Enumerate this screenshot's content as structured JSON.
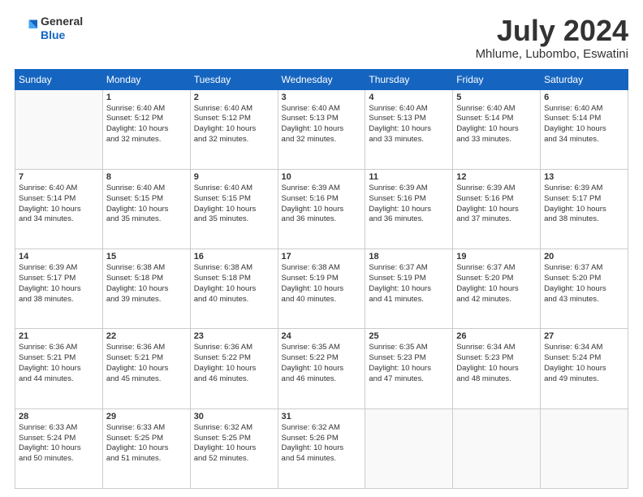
{
  "logo": {
    "general": "General",
    "blue": "Blue"
  },
  "header": {
    "month": "July 2024",
    "location": "Mhlume, Lubombo, Eswatini"
  },
  "weekdays": [
    "Sunday",
    "Monday",
    "Tuesday",
    "Wednesday",
    "Thursday",
    "Friday",
    "Saturday"
  ],
  "weeks": [
    [
      {
        "day": "",
        "info": ""
      },
      {
        "day": "1",
        "info": "Sunrise: 6:40 AM\nSunset: 5:12 PM\nDaylight: 10 hours\nand 32 minutes."
      },
      {
        "day": "2",
        "info": "Sunrise: 6:40 AM\nSunset: 5:12 PM\nDaylight: 10 hours\nand 32 minutes."
      },
      {
        "day": "3",
        "info": "Sunrise: 6:40 AM\nSunset: 5:13 PM\nDaylight: 10 hours\nand 32 minutes."
      },
      {
        "day": "4",
        "info": "Sunrise: 6:40 AM\nSunset: 5:13 PM\nDaylight: 10 hours\nand 33 minutes."
      },
      {
        "day": "5",
        "info": "Sunrise: 6:40 AM\nSunset: 5:14 PM\nDaylight: 10 hours\nand 33 minutes."
      },
      {
        "day": "6",
        "info": "Sunrise: 6:40 AM\nSunset: 5:14 PM\nDaylight: 10 hours\nand 34 minutes."
      }
    ],
    [
      {
        "day": "7",
        "info": "Sunrise: 6:40 AM\nSunset: 5:14 PM\nDaylight: 10 hours\nand 34 minutes."
      },
      {
        "day": "8",
        "info": "Sunrise: 6:40 AM\nSunset: 5:15 PM\nDaylight: 10 hours\nand 35 minutes."
      },
      {
        "day": "9",
        "info": "Sunrise: 6:40 AM\nSunset: 5:15 PM\nDaylight: 10 hours\nand 35 minutes."
      },
      {
        "day": "10",
        "info": "Sunrise: 6:39 AM\nSunset: 5:16 PM\nDaylight: 10 hours\nand 36 minutes."
      },
      {
        "day": "11",
        "info": "Sunrise: 6:39 AM\nSunset: 5:16 PM\nDaylight: 10 hours\nand 36 minutes."
      },
      {
        "day": "12",
        "info": "Sunrise: 6:39 AM\nSunset: 5:16 PM\nDaylight: 10 hours\nand 37 minutes."
      },
      {
        "day": "13",
        "info": "Sunrise: 6:39 AM\nSunset: 5:17 PM\nDaylight: 10 hours\nand 38 minutes."
      }
    ],
    [
      {
        "day": "14",
        "info": "Sunrise: 6:39 AM\nSunset: 5:17 PM\nDaylight: 10 hours\nand 38 minutes."
      },
      {
        "day": "15",
        "info": "Sunrise: 6:38 AM\nSunset: 5:18 PM\nDaylight: 10 hours\nand 39 minutes."
      },
      {
        "day": "16",
        "info": "Sunrise: 6:38 AM\nSunset: 5:18 PM\nDaylight: 10 hours\nand 40 minutes."
      },
      {
        "day": "17",
        "info": "Sunrise: 6:38 AM\nSunset: 5:19 PM\nDaylight: 10 hours\nand 40 minutes."
      },
      {
        "day": "18",
        "info": "Sunrise: 6:37 AM\nSunset: 5:19 PM\nDaylight: 10 hours\nand 41 minutes."
      },
      {
        "day": "19",
        "info": "Sunrise: 6:37 AM\nSunset: 5:20 PM\nDaylight: 10 hours\nand 42 minutes."
      },
      {
        "day": "20",
        "info": "Sunrise: 6:37 AM\nSunset: 5:20 PM\nDaylight: 10 hours\nand 43 minutes."
      }
    ],
    [
      {
        "day": "21",
        "info": "Sunrise: 6:36 AM\nSunset: 5:21 PM\nDaylight: 10 hours\nand 44 minutes."
      },
      {
        "day": "22",
        "info": "Sunrise: 6:36 AM\nSunset: 5:21 PM\nDaylight: 10 hours\nand 45 minutes."
      },
      {
        "day": "23",
        "info": "Sunrise: 6:36 AM\nSunset: 5:22 PM\nDaylight: 10 hours\nand 46 minutes."
      },
      {
        "day": "24",
        "info": "Sunrise: 6:35 AM\nSunset: 5:22 PM\nDaylight: 10 hours\nand 46 minutes."
      },
      {
        "day": "25",
        "info": "Sunrise: 6:35 AM\nSunset: 5:23 PM\nDaylight: 10 hours\nand 47 minutes."
      },
      {
        "day": "26",
        "info": "Sunrise: 6:34 AM\nSunset: 5:23 PM\nDaylight: 10 hours\nand 48 minutes."
      },
      {
        "day": "27",
        "info": "Sunrise: 6:34 AM\nSunset: 5:24 PM\nDaylight: 10 hours\nand 49 minutes."
      }
    ],
    [
      {
        "day": "28",
        "info": "Sunrise: 6:33 AM\nSunset: 5:24 PM\nDaylight: 10 hours\nand 50 minutes."
      },
      {
        "day": "29",
        "info": "Sunrise: 6:33 AM\nSunset: 5:25 PM\nDaylight: 10 hours\nand 51 minutes."
      },
      {
        "day": "30",
        "info": "Sunrise: 6:32 AM\nSunset: 5:25 PM\nDaylight: 10 hours\nand 52 minutes."
      },
      {
        "day": "31",
        "info": "Sunrise: 6:32 AM\nSunset: 5:26 PM\nDaylight: 10 hours\nand 54 minutes."
      },
      {
        "day": "",
        "info": ""
      },
      {
        "day": "",
        "info": ""
      },
      {
        "day": "",
        "info": ""
      }
    ]
  ]
}
